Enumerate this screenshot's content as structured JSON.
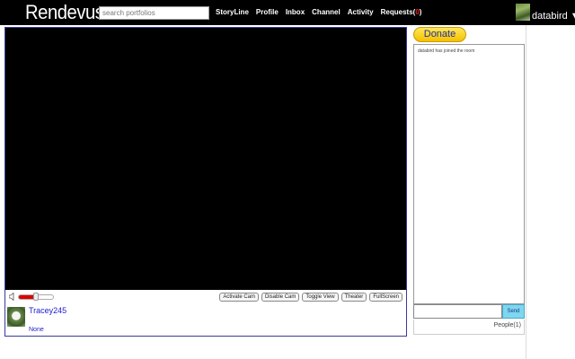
{
  "header": {
    "logo": "Rendevus",
    "search_placeholder": "search portfolios",
    "nav": [
      {
        "label": "StoryLine"
      },
      {
        "label": "Profile"
      },
      {
        "label": "Inbox"
      },
      {
        "label": "Channel"
      },
      {
        "label": "Activity"
      },
      {
        "label": "Requests",
        "count": "0"
      }
    ],
    "user": "databird ▼"
  },
  "player": {
    "volume_fraction": 0.5,
    "buttons": [
      "Activate Cam",
      "Disable Cam",
      "Toggle View",
      "Theater",
      "FullScreen"
    ],
    "host_name": "Tracey245",
    "host_status": "None",
    "colors": {
      "volume": "#e00000",
      "link": "#1a1ad0",
      "panel_border": "#3a3aa0"
    }
  },
  "sidebar": {
    "donate_label": "Donate",
    "chat_messages": [
      "databird has joined the room"
    ],
    "chat_input_value": "",
    "send_label": "Send",
    "people_label": "People(1)"
  }
}
